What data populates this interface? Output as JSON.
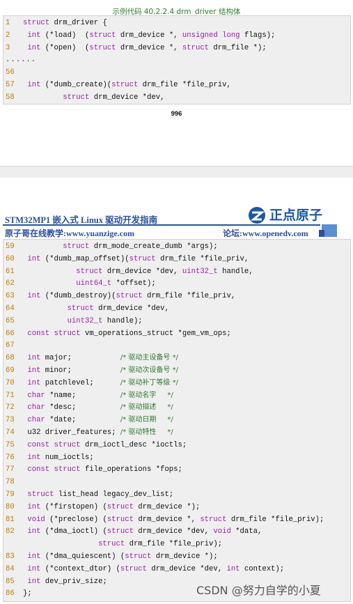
{
  "caption": "示例代码 40.2.2.4 drm_driver 结构体",
  "page_number": "996",
  "header": {
    "title": "STM32MP1 嵌入式 Linux 驱动开发指南",
    "left": "原子哥在线教学:www.yuanzige.com",
    "right": "论坛:www.openedv.com",
    "logo_text": "正点原子"
  },
  "watermark": "CSDN @努力自学的小夏",
  "code_top": [
    {
      "num": "1",
      "segs": [
        [
          "kw",
          "struct"
        ],
        [
          "t",
          " drm_driver {"
        ]
      ]
    },
    {
      "num": "2",
      "segs": [
        [
          "t",
          " "
        ],
        [
          "kw",
          "int"
        ],
        [
          "t",
          " (*load)  ("
        ],
        [
          "kw",
          "struct"
        ],
        [
          "t",
          " drm_device *, "
        ],
        [
          "kw",
          "unsigned long"
        ],
        [
          "t",
          " flags);"
        ]
      ]
    },
    {
      "num": "3",
      "segs": [
        [
          "t",
          " "
        ],
        [
          "kw",
          "int"
        ],
        [
          "t",
          " (*open)  ("
        ],
        [
          "kw",
          "struct"
        ],
        [
          "t",
          " drm_device *, "
        ],
        [
          "kw",
          "struct"
        ],
        [
          "t",
          " drm_file *);"
        ]
      ]
    },
    {
      "num": "......",
      "dots": true,
      "segs": []
    },
    {
      "num": "56",
      "segs": []
    },
    {
      "num": "57",
      "segs": [
        [
          "t",
          " "
        ],
        [
          "kw",
          "int"
        ],
        [
          "t",
          " (*dumb_create)("
        ],
        [
          "kw",
          "struct"
        ],
        [
          "t",
          " drm_file *file_priv,"
        ]
      ]
    },
    {
      "num": "58",
      "segs": [
        [
          "t",
          "         "
        ],
        [
          "kw",
          "struct"
        ],
        [
          "t",
          " drm_device *dev,"
        ]
      ]
    }
  ],
  "code_bottom": [
    {
      "num": "59",
      "segs": [
        [
          "t",
          "         "
        ],
        [
          "kw",
          "struct"
        ],
        [
          "t",
          " drm_mode_create_dumb *args);"
        ]
      ]
    },
    {
      "num": "60",
      "segs": [
        [
          "t",
          " "
        ],
        [
          "kw",
          "int"
        ],
        [
          "t",
          " (*dumb_map_offset)("
        ],
        [
          "kw",
          "struct"
        ],
        [
          "t",
          " drm_file *file_priv,"
        ]
      ]
    },
    {
      "num": "61",
      "segs": [
        [
          "t",
          "            "
        ],
        [
          "kw",
          "struct"
        ],
        [
          "t",
          " drm_device *dev, "
        ],
        [
          "kw",
          "uint32_t"
        ],
        [
          "t",
          " handle,"
        ]
      ]
    },
    {
      "num": "62",
      "segs": [
        [
          "t",
          "            "
        ],
        [
          "kw",
          "uint64_t"
        ],
        [
          "t",
          " *offset);"
        ]
      ]
    },
    {
      "num": "63",
      "segs": [
        [
          "t",
          " "
        ],
        [
          "kw",
          "int"
        ],
        [
          "t",
          " (*dumb_destroy)("
        ],
        [
          "kw",
          "struct"
        ],
        [
          "t",
          " drm_file *file_priv,"
        ]
      ]
    },
    {
      "num": "64",
      "segs": [
        [
          "t",
          "          "
        ],
        [
          "kw",
          "struct"
        ],
        [
          "t",
          " drm_device *dev,"
        ]
      ]
    },
    {
      "num": "65",
      "segs": [
        [
          "t",
          "          "
        ],
        [
          "kw",
          "uint32_t"
        ],
        [
          "t",
          " handle);"
        ]
      ]
    },
    {
      "num": "66",
      "segs": [
        [
          "t",
          " "
        ],
        [
          "kw",
          "const struct"
        ],
        [
          "t",
          " vm_operations_struct *gem_vm_ops;"
        ]
      ]
    },
    {
      "num": "67",
      "segs": []
    },
    {
      "num": "68",
      "segs": [
        [
          "t",
          " "
        ],
        [
          "kw",
          "int"
        ],
        [
          "t",
          " major;           "
        ],
        [
          "cm",
          "/* 驱动主设备号 */"
        ]
      ]
    },
    {
      "num": "69",
      "segs": [
        [
          "t",
          " "
        ],
        [
          "kw",
          "int"
        ],
        [
          "t",
          " minor;           "
        ],
        [
          "cm",
          "/* 驱动次设备号 */"
        ]
      ]
    },
    {
      "num": "70",
      "segs": [
        [
          "t",
          " "
        ],
        [
          "kw",
          "int"
        ],
        [
          "t",
          " patchlevel;      "
        ],
        [
          "cm",
          "/* 驱动补丁等级 */"
        ]
      ]
    },
    {
      "num": "71",
      "segs": [
        [
          "t",
          " "
        ],
        [
          "kw",
          "char"
        ],
        [
          "t",
          " *name;          "
        ],
        [
          "cm",
          "/* 驱动名字     */"
        ]
      ]
    },
    {
      "num": "72",
      "segs": [
        [
          "t",
          " "
        ],
        [
          "kw",
          "char"
        ],
        [
          "t",
          " *desc;          "
        ],
        [
          "cm",
          "/* 驱动描述     */"
        ]
      ]
    },
    {
      "num": "73",
      "segs": [
        [
          "t",
          " "
        ],
        [
          "kw",
          "char"
        ],
        [
          "t",
          " *date;          "
        ],
        [
          "cm",
          "/* 驱动日期     */"
        ]
      ]
    },
    {
      "num": "74",
      "segs": [
        [
          "t",
          " u32 driver_features; "
        ],
        [
          "cm",
          "/* 驱动特性     */"
        ]
      ]
    },
    {
      "num": "75",
      "segs": [
        [
          "t",
          " "
        ],
        [
          "kw",
          "const struct"
        ],
        [
          "t",
          " drm_ioctl_desc *ioctls;"
        ]
      ]
    },
    {
      "num": "76",
      "segs": [
        [
          "t",
          " "
        ],
        [
          "kw",
          "int"
        ],
        [
          "t",
          " num_ioctls;"
        ]
      ]
    },
    {
      "num": "77",
      "segs": [
        [
          "t",
          " "
        ],
        [
          "kw",
          "const struct"
        ],
        [
          "t",
          " file_operations *fops;"
        ]
      ]
    },
    {
      "num": "78",
      "segs": []
    },
    {
      "num": "79",
      "segs": [
        [
          "t",
          " "
        ],
        [
          "kw",
          "struct"
        ],
        [
          "t",
          " list_head legacy_dev_list;"
        ]
      ]
    },
    {
      "num": "80",
      "segs": [
        [
          "t",
          " "
        ],
        [
          "kw",
          "int"
        ],
        [
          "t",
          " (*firstopen) ("
        ],
        [
          "kw",
          "struct"
        ],
        [
          "t",
          " drm_device *);"
        ]
      ]
    },
    {
      "num": "81",
      "segs": [
        [
          "t",
          " "
        ],
        [
          "kw",
          "void"
        ],
        [
          "t",
          " (*preclose) ("
        ],
        [
          "kw",
          "struct"
        ],
        [
          "t",
          " drm_device *, "
        ],
        [
          "kw",
          "struct"
        ],
        [
          "t",
          " drm_file *file_priv);"
        ]
      ]
    },
    {
      "num": "82",
      "segs": [
        [
          "t",
          " "
        ],
        [
          "kw",
          "int"
        ],
        [
          "t",
          " (*dma_ioctl) ("
        ],
        [
          "kw",
          "struct"
        ],
        [
          "t",
          " drm_device *dev, "
        ],
        [
          "kw",
          "void"
        ],
        [
          "t",
          " *data,"
        ]
      ]
    },
    {
      "num": "",
      "segs": [
        [
          "t",
          "                 "
        ],
        [
          "kw",
          "struct"
        ],
        [
          "t",
          " drm_file *file_priv);"
        ]
      ]
    },
    {
      "num": "83",
      "segs": [
        [
          "t",
          " "
        ],
        [
          "kw",
          "int"
        ],
        [
          "t",
          " (*dma_quiescent) ("
        ],
        [
          "kw",
          "struct"
        ],
        [
          "t",
          " drm_device *);"
        ]
      ]
    },
    {
      "num": "84",
      "segs": [
        [
          "t",
          " "
        ],
        [
          "kw",
          "int"
        ],
        [
          "t",
          " (*context_dtor) ("
        ],
        [
          "kw",
          "struct"
        ],
        [
          "t",
          " drm_device *dev, "
        ],
        [
          "kw",
          "int"
        ],
        [
          "t",
          " context);"
        ]
      ]
    },
    {
      "num": "85",
      "segs": [
        [
          "t",
          " "
        ],
        [
          "kw",
          "int"
        ],
        [
          "t",
          " dev_priv_size;"
        ]
      ]
    },
    {
      "num": "86",
      "segs": [
        [
          "t",
          "};"
        ]
      ]
    }
  ]
}
